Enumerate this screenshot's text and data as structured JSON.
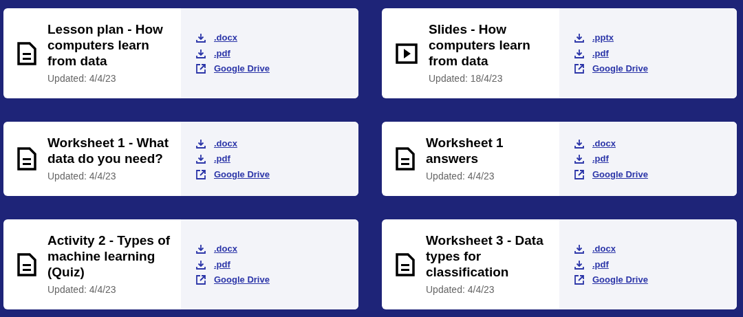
{
  "resources": [
    {
      "kind": "document",
      "title": "Lesson plan - How computers learn from data",
      "updated": "Updated: 4/4/23",
      "links": [
        {
          "kind": "download",
          "label": ".docx"
        },
        {
          "kind": "download",
          "label": ".pdf"
        },
        {
          "kind": "external",
          "label": "Google Drive"
        }
      ]
    },
    {
      "kind": "slides",
      "title": "Slides - How computers learn from data",
      "updated": "Updated: 18/4/23",
      "links": [
        {
          "kind": "download",
          "label": ".pptx"
        },
        {
          "kind": "download",
          "label": ".pdf"
        },
        {
          "kind": "external",
          "label": "Google Drive"
        }
      ]
    },
    {
      "kind": "document",
      "title": "Worksheet 1 - What data do you need?",
      "updated": "Updated: 4/4/23",
      "links": [
        {
          "kind": "download",
          "label": ".docx"
        },
        {
          "kind": "download",
          "label": ".pdf"
        },
        {
          "kind": "external",
          "label": "Google Drive"
        }
      ]
    },
    {
      "kind": "document",
      "title": "Worksheet 1 answers",
      "updated": "Updated: 4/4/23",
      "links": [
        {
          "kind": "download",
          "label": ".docx"
        },
        {
          "kind": "download",
          "label": ".pdf"
        },
        {
          "kind": "external",
          "label": "Google Drive"
        }
      ]
    },
    {
      "kind": "document",
      "title": "Activity 2 - Types of machine learning (Quiz)",
      "updated": "Updated: 4/4/23",
      "links": [
        {
          "kind": "download",
          "label": ".docx"
        },
        {
          "kind": "download",
          "label": ".pdf"
        },
        {
          "kind": "external",
          "label": "Google Drive"
        }
      ]
    },
    {
      "kind": "document",
      "title": "Worksheet 3 - Data types for classification",
      "updated": "Updated: 4/4/23",
      "links": [
        {
          "kind": "download",
          "label": ".docx"
        },
        {
          "kind": "download",
          "label": ".pdf"
        },
        {
          "kind": "external",
          "label": "Google Drive"
        }
      ]
    }
  ]
}
